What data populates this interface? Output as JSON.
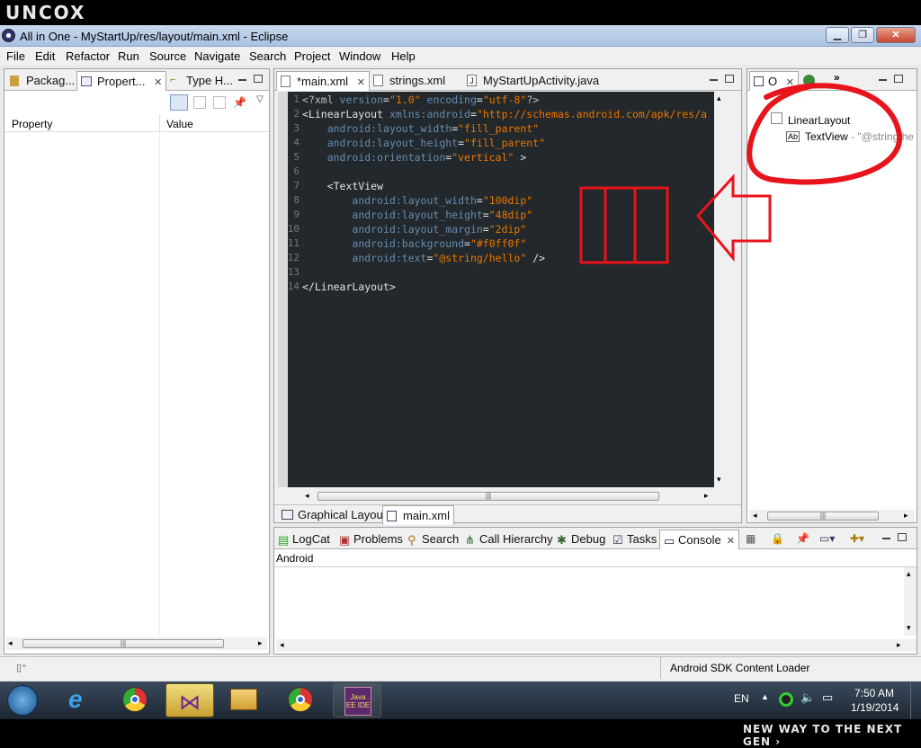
{
  "banner": {
    "logo": "uncox",
    "tagline": "NEW WAY TO THE NEXT GEN ›"
  },
  "window": {
    "title": "All in One - MyStartUp/res/layout/main.xml - Eclipse"
  },
  "menu": [
    "File",
    "Edit",
    "Refactor",
    "Run",
    "Source",
    "Navigate",
    "Search",
    "Project",
    "Window",
    "Help"
  ],
  "left_panel": {
    "tabs": [
      "Packag...",
      "Propert...",
      "Type H..."
    ],
    "columns": [
      "Property",
      "Value"
    ]
  },
  "editor": {
    "tabs": [
      "*main.xml",
      "strings.xml",
      "MyStartUpActivity.java"
    ],
    "bottom_tabs": [
      "Graphical Layout",
      "main.xml"
    ],
    "lines": [
      {
        "n": "1",
        "parts": [
          [
            "c-pi",
            "<?xml "
          ],
          [
            "c-attr",
            "version"
          ],
          [
            "c-tag",
            "="
          ],
          [
            "c-val",
            "\"1.0\""
          ],
          [
            "c-tag",
            " "
          ],
          [
            "c-attr",
            "encoding"
          ],
          [
            "c-tag",
            "="
          ],
          [
            "c-val",
            "\"utf-8\""
          ],
          [
            "c-pi",
            "?>"
          ]
        ]
      },
      {
        "n": "2",
        "parts": [
          [
            "c-tag",
            "<LinearLayout "
          ],
          [
            "c-attr",
            "xmlns:android"
          ],
          [
            "c-tag",
            "="
          ],
          [
            "c-val",
            "\"http://schemas.android.com/apk/res/a"
          ]
        ]
      },
      {
        "n": "3",
        "parts": [
          [
            "c-tag",
            "    "
          ],
          [
            "c-attr",
            "android:layout_width"
          ],
          [
            "c-tag",
            "="
          ],
          [
            "c-val",
            "\"fill_parent\""
          ]
        ]
      },
      {
        "n": "4",
        "parts": [
          [
            "c-tag",
            "    "
          ],
          [
            "c-attr",
            "android:layout_height"
          ],
          [
            "c-tag",
            "="
          ],
          [
            "c-val",
            "\"fill_parent\""
          ]
        ]
      },
      {
        "n": "5",
        "parts": [
          [
            "c-tag",
            "    "
          ],
          [
            "c-attr",
            "android:orientation"
          ],
          [
            "c-tag",
            "="
          ],
          [
            "c-val",
            "\"vertical\""
          ],
          [
            "c-tag",
            " >"
          ]
        ]
      },
      {
        "n": "6",
        "parts": []
      },
      {
        "n": "7",
        "parts": [
          [
            "c-tag",
            "    <TextView"
          ]
        ]
      },
      {
        "n": "8",
        "parts": [
          [
            "c-tag",
            "        "
          ],
          [
            "c-attr",
            "android:layout_width"
          ],
          [
            "c-tag",
            "="
          ],
          [
            "c-val",
            "\"100dip\""
          ]
        ]
      },
      {
        "n": "9",
        "parts": [
          [
            "c-tag",
            "        "
          ],
          [
            "c-attr",
            "android:layout_height"
          ],
          [
            "c-tag",
            "="
          ],
          [
            "c-val",
            "\"48dip\""
          ]
        ]
      },
      {
        "n": "10",
        "parts": [
          [
            "c-tag",
            "        "
          ],
          [
            "c-attr",
            "android:layout_margin"
          ],
          [
            "c-tag",
            "="
          ],
          [
            "c-val",
            "\"2dip\""
          ]
        ]
      },
      {
        "n": "11",
        "parts": [
          [
            "c-tag",
            "        "
          ],
          [
            "c-attr",
            "android:background"
          ],
          [
            "c-tag",
            "="
          ],
          [
            "c-val",
            "\"#f0ff0f\""
          ]
        ]
      },
      {
        "n": "12",
        "parts": [
          [
            "c-tag",
            "        "
          ],
          [
            "c-attr",
            "android:text"
          ],
          [
            "c-tag",
            "="
          ],
          [
            "c-val",
            "\"@string/hello\""
          ],
          [
            "c-tag",
            " />"
          ]
        ]
      },
      {
        "n": "13",
        "parts": []
      },
      {
        "n": "14",
        "parts": [
          [
            "c-tag",
            "</LinearLayout>"
          ]
        ]
      }
    ]
  },
  "outline": {
    "tab": "O",
    "root": "LinearLayout",
    "child_badge": "Ab",
    "child": "TextView",
    "child_suffix": " - \"@string/he"
  },
  "bottom_panel": {
    "tabs": [
      "LogCat",
      "Problems",
      "Search",
      "Call Hierarchy",
      "Debug",
      "Tasks",
      "Console"
    ],
    "console_label": "Android"
  },
  "status": {
    "task": "Android SDK Content Loader"
  },
  "taskbar": {
    "lang": "EN",
    "time": "7:50 AM",
    "date": "1/19/2014",
    "javaee_label": "Java EE IDE"
  },
  "annotation_color": "#e8141c"
}
